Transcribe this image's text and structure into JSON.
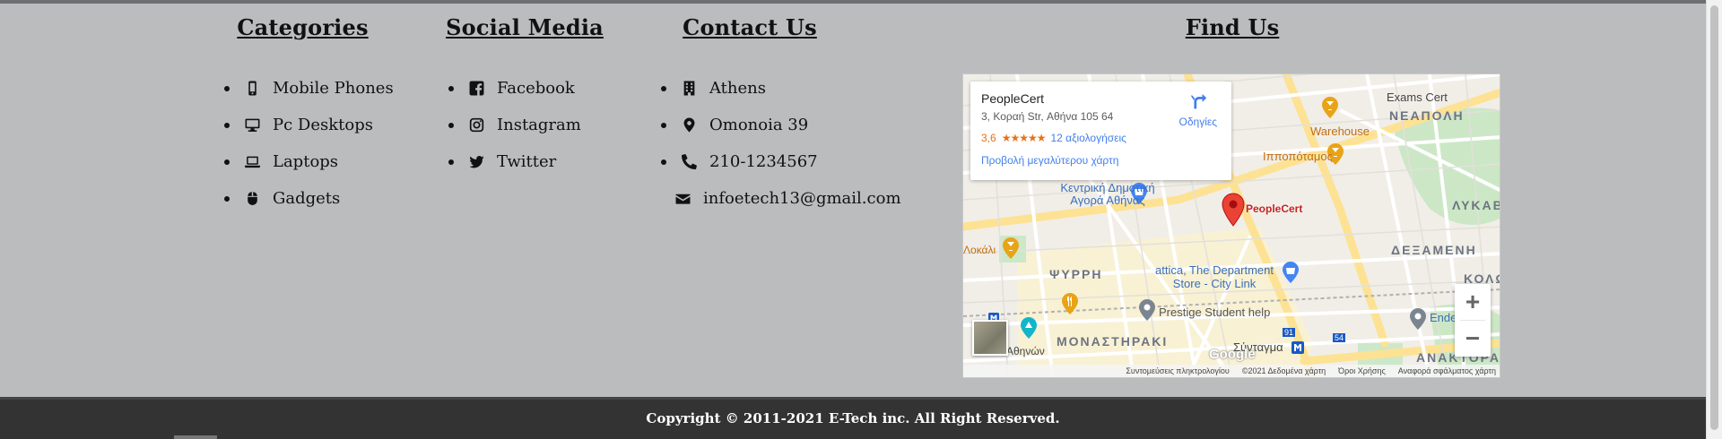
{
  "categories": {
    "title": "Categories",
    "items": [
      {
        "label": "Mobile Phones",
        "icon": "mobile-icon"
      },
      {
        "label": "Pc Desktops",
        "icon": "desktop-icon"
      },
      {
        "label": "Laptops",
        "icon": "laptop-icon"
      },
      {
        "label": "Gadgets",
        "icon": "mouse-icon"
      }
    ]
  },
  "social": {
    "title": "Social Media",
    "items": [
      {
        "label": "Facebook",
        "icon": "facebook-icon"
      },
      {
        "label": "Instagram",
        "icon": "instagram-icon"
      },
      {
        "label": "Twitter",
        "icon": "twitter-icon"
      }
    ]
  },
  "contact": {
    "title": "Contact Us",
    "items": [
      {
        "label": "Athens",
        "icon": "building-icon"
      },
      {
        "label": "Omonoia 39",
        "icon": "map-marker-icon"
      },
      {
        "label": "210-1234567",
        "icon": "phone-icon"
      },
      {
        "label": "infoetech13@gmail.com",
        "icon": "envelope-icon"
      }
    ]
  },
  "find": {
    "title": "Find Us",
    "map": {
      "place_name": "PeopleCert",
      "address": "3, Κοραή Str, Αθήνα 105 64",
      "rating": "3,6",
      "stars": "★★★★★",
      "reviews": "12 αξιολογήσεις",
      "bigger_map": "Προβολή μεγαλύτερου χάρτη",
      "directions": "Οδηγίες",
      "pin_label": "PeopleCert",
      "zoom_in": "+",
      "zoom_out": "−",
      "google_logo": "Google",
      "labels": {
        "exams_cert": "Exams Cert",
        "neapoli": "ΝΕΑΠΟΛΗ",
        "warehouse": "Warehouse",
        "ippopotamos": "Ιπποπόταμος",
        "lykavittos": "ΛΥΚΑΒ",
        "market": "Κεντρική Δημοτική Αγορά Αθήνας",
        "psyrri": "ΨΥΡΡΗ",
        "attica": "attica, The Department Store - City Link",
        "dexameni": "ΔΕΞΑΜΕΝΗ",
        "kolo": "ΚΟΛΩ",
        "prestige": "Prestige Student help",
        "monastiraki": "ΜΟΝΑΣΤΗΡΑΚΙ",
        "syntagma": "Σύνταγμα",
        "anakt": "ΑΝΑΚΤΟΡΑ",
        "endeav": "Endea",
        "athinon": "Αθηνών",
        "lokali": "Λοκάλι",
        "metro_91": "91",
        "metro_54": "54"
      },
      "attribution": [
        "Συντομεύσεις πληκτρολογίου",
        "©2021 Δεδομένα χάρτη",
        "Όροι Χρήσης",
        "Αναφορά σφάλματος χάρτη"
      ]
    }
  },
  "footer": {
    "copyright": "Copyright © 2011-2021 E-Tech inc. All Right Reserved."
  },
  "colors": {
    "background": "#bbbcbe",
    "footer": "#333333",
    "link": "#427fed",
    "rating": "#e7711b",
    "pin": "#ea4335"
  }
}
